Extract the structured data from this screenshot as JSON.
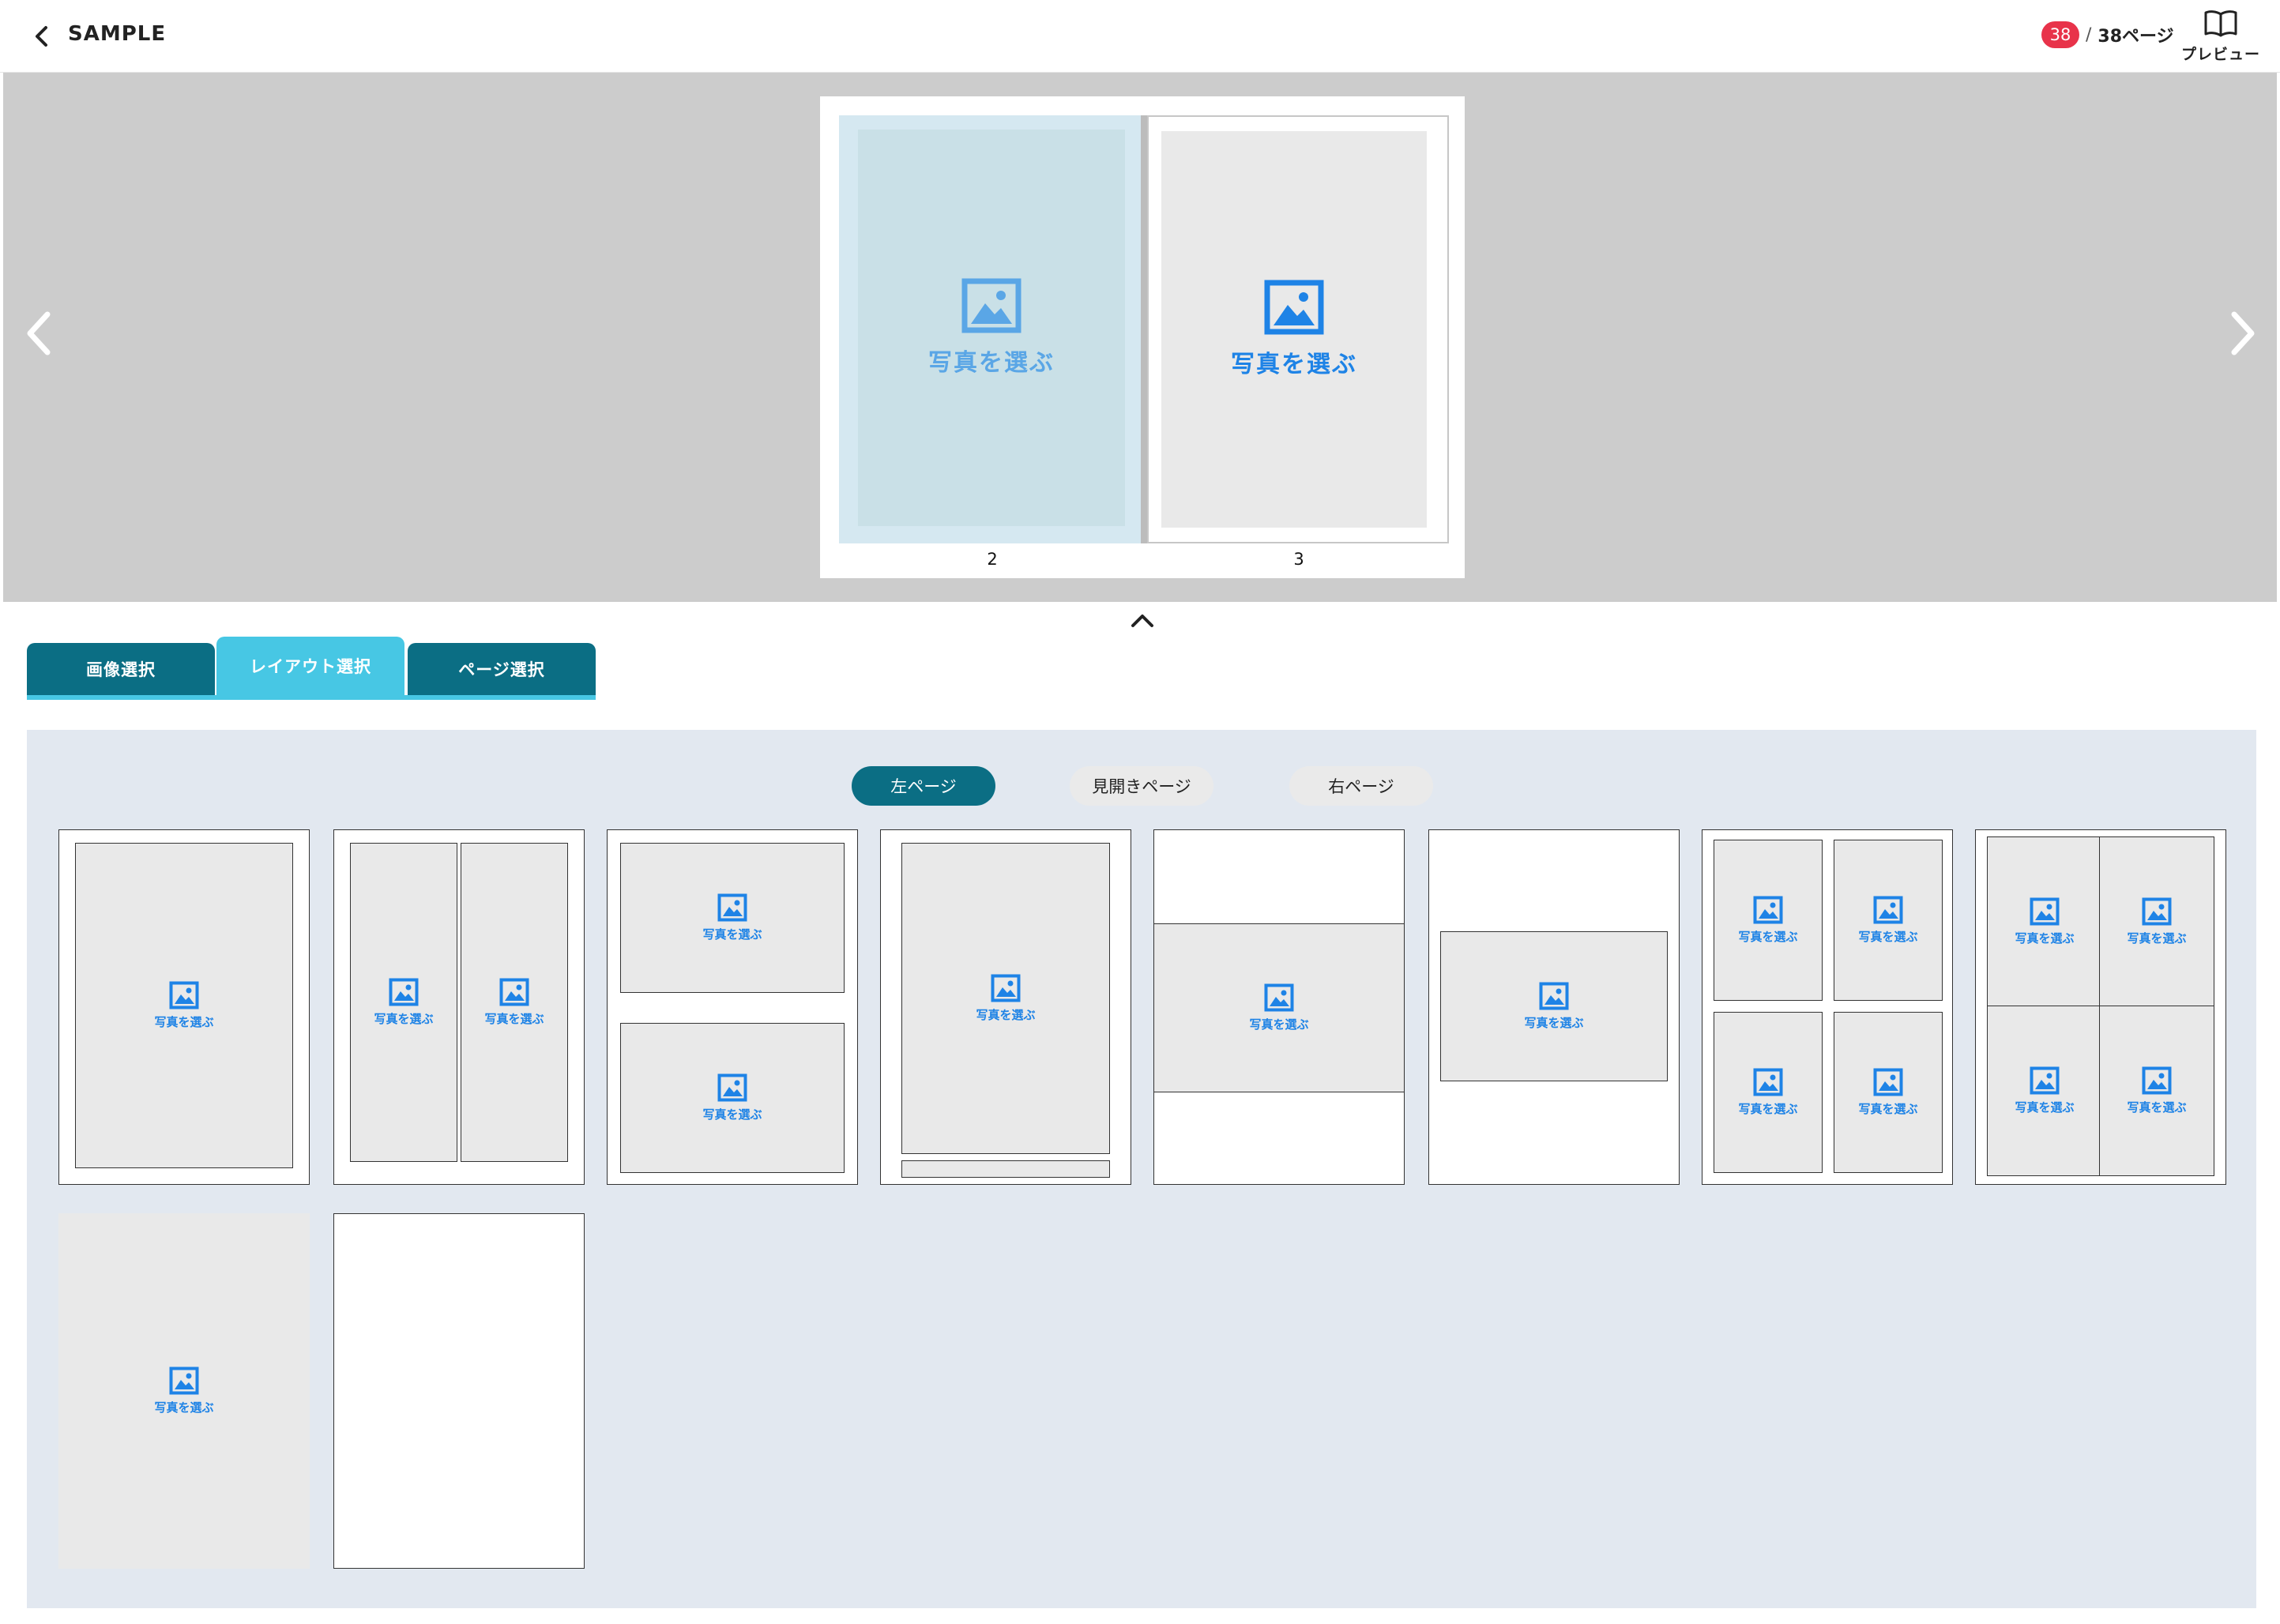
{
  "header": {
    "title": "SAMPLE",
    "page_count_badge": "38",
    "page_count_separator": "/",
    "page_count_total": "38ページ",
    "preview_label": "プレビュー"
  },
  "spread": {
    "left_page_number": "2",
    "right_page_number": "3",
    "photo_prompt": "写真を選ぶ"
  },
  "tabs": [
    {
      "label": "画像選択",
      "active": false
    },
    {
      "label": "レイアウト選択",
      "active": true
    },
    {
      "label": "ページ選択",
      "active": false
    }
  ],
  "layout_panel": {
    "segments": [
      {
        "label": "左ページ",
        "active": true
      },
      {
        "label": "見開きページ",
        "active": false
      },
      {
        "label": "右ページ",
        "active": false
      }
    ],
    "photo_prompt": "写真を選ぶ"
  },
  "colors": {
    "accent": "#0b6e84",
    "accent_light": "#47c7e4",
    "badge": "#e8334a",
    "photo_blue": "#1e83e6"
  }
}
